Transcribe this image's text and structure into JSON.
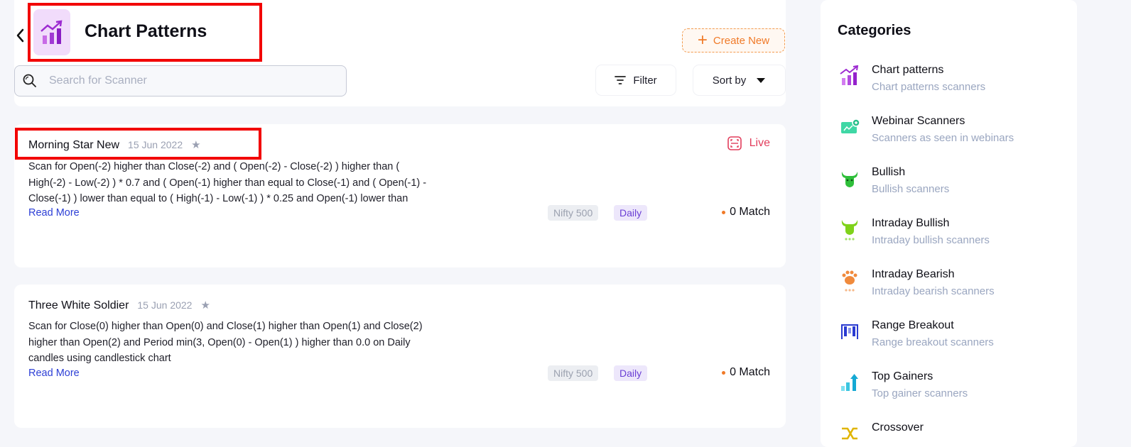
{
  "header": {
    "title": "Chart Patterns",
    "create_label": "Create New",
    "search_placeholder": "Search for Scanner",
    "filter_label": "Filter",
    "sort_label": "Sort by"
  },
  "scanners": [
    {
      "name": "Morning Star New",
      "date": "15 Jun 2022",
      "status": "Live",
      "description_lines": [
        "Scan for Open(-2) higher than Close(-2) and ( Open(-2) - Close(-2) ) higher than (",
        "High(-2) - Low(-2) ) * 0.7 and ( Open(-1) higher than equal to Close(-1) and ( Open(-1) -",
        "Close(-1) ) lower than equal to ( High(-1) - Low(-1) ) * 0.25 and Open(-1) lower than"
      ],
      "read_more": "Read More",
      "universe": "Nifty 500",
      "timeframe": "Daily",
      "match": "0 Match"
    },
    {
      "name": "Three White Soldier",
      "date": "15 Jun 2022",
      "description_lines": [
        "Scan for Close(0) higher than Open(0) and Close(1) higher than Open(1) and Close(2)",
        "higher than Open(2) and Period min(3, Open(0) - Open(1) ) higher than 0.0 on Daily",
        "candles using candlestick chart"
      ],
      "read_more": "Read More",
      "universe": "Nifty 500",
      "timeframe": "Daily",
      "match": "0 Match"
    }
  ],
  "sidebar": {
    "title": "Categories",
    "items": [
      {
        "label": "Chart patterns",
        "sub": "Chart patterns scanners",
        "icon": "chart-patterns-icon"
      },
      {
        "label": "Webinar Scanners",
        "sub": "Scanners as seen in webinars",
        "icon": "webinar-icon"
      },
      {
        "label": "Bullish",
        "sub": "Bullish scanners",
        "icon": "bull-icon"
      },
      {
        "label": "Intraday Bullish",
        "sub": "Intraday bullish scanners",
        "icon": "intraday-bull-icon"
      },
      {
        "label": "Intraday Bearish",
        "sub": "Intraday bearish scanners",
        "icon": "bear-paw-icon"
      },
      {
        "label": "Range Breakout",
        "sub": "Range breakout scanners",
        "icon": "range-breakout-icon"
      },
      {
        "label": "Top Gainers",
        "sub": "Top gainer scanners",
        "icon": "top-gainers-icon"
      },
      {
        "label": "Crossover",
        "sub": "",
        "icon": "crossover-icon"
      }
    ]
  },
  "colors": {
    "accent_orange": "#f07a28",
    "live_red": "#e23d5c",
    "link_blue": "#2d3fd6",
    "highlight_red": "#f20000"
  }
}
